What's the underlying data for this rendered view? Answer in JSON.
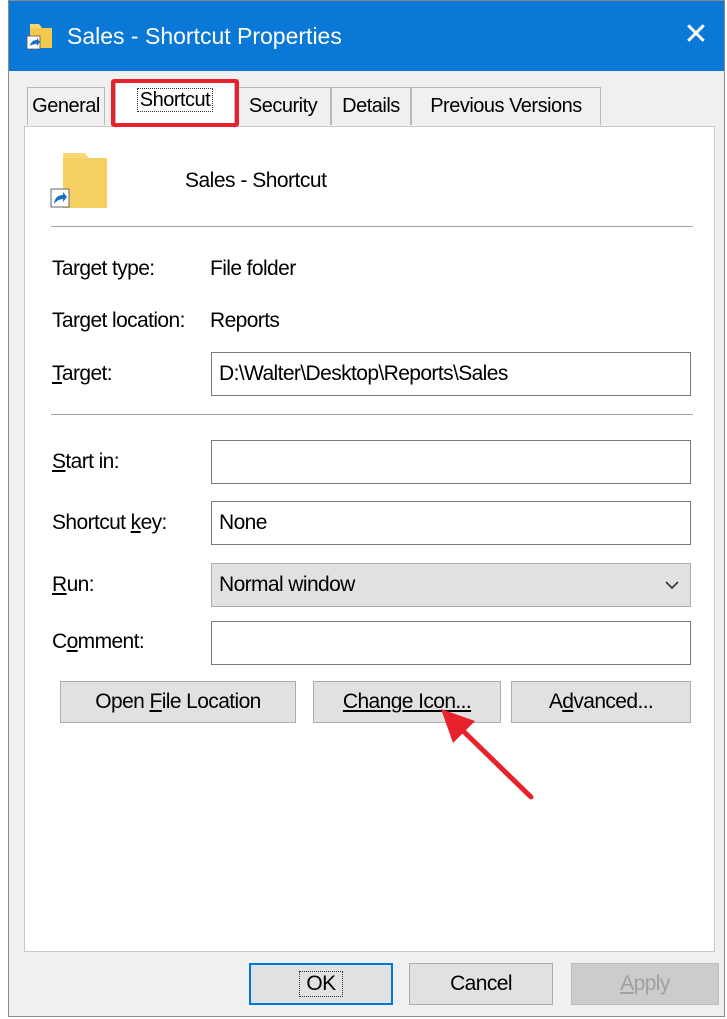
{
  "window": {
    "title": "Sales - Shortcut Properties",
    "close_glyph": "✕"
  },
  "tabs": [
    {
      "label": "General"
    },
    {
      "label": "Shortcut"
    },
    {
      "label": "Security"
    },
    {
      "label": "Details"
    },
    {
      "label": "Previous Versions"
    }
  ],
  "active_tab": "Shortcut",
  "shortcut": {
    "name": "Sales - Shortcut",
    "target_type": {
      "label": "Target type:",
      "value": "File folder"
    },
    "target_location": {
      "label": "Target location:",
      "value": "Reports"
    },
    "target": {
      "label_pre": "",
      "label_key": "T",
      "label_post": "arget:",
      "value": "D:\\Walter\\Desktop\\Reports\\Sales"
    },
    "start_in": {
      "label_pre": "",
      "label_key": "S",
      "label_post": "tart in:",
      "value": ""
    },
    "shortcut_key": {
      "label_pre": "Shortcut ",
      "label_key": "k",
      "label_post": "ey:",
      "value": "None"
    },
    "run": {
      "label_pre": "",
      "label_key": "R",
      "label_post": "un:",
      "value": "Normal window"
    },
    "comment": {
      "label_pre": "C",
      "label_key": "o",
      "label_post": "mment:",
      "value": ""
    }
  },
  "buttons": {
    "open_file_location": {
      "pre": "Open ",
      "key": "F",
      "post": "ile Location"
    },
    "change_icon": {
      "pre": "",
      "key": "C",
      "post": "hange Icon..."
    },
    "advanced": {
      "pre": "A",
      "key": "d",
      "post": "vanced..."
    },
    "ok": "OK",
    "cancel": "Cancel",
    "apply": {
      "pre": "",
      "key": "A",
      "post": "pply"
    }
  },
  "icons": {
    "title": "folder-shortcut-icon",
    "big": "folder-shortcut-icon",
    "close": "close-icon",
    "dropdown": "chevron-down-icon",
    "annotation": "red-arrow-icon"
  },
  "colors": {
    "titlebar": "#0a78d7",
    "highlight": "#e8212a",
    "folder": "#f8d775",
    "shortcut_arrow": "#1a6fc9"
  }
}
